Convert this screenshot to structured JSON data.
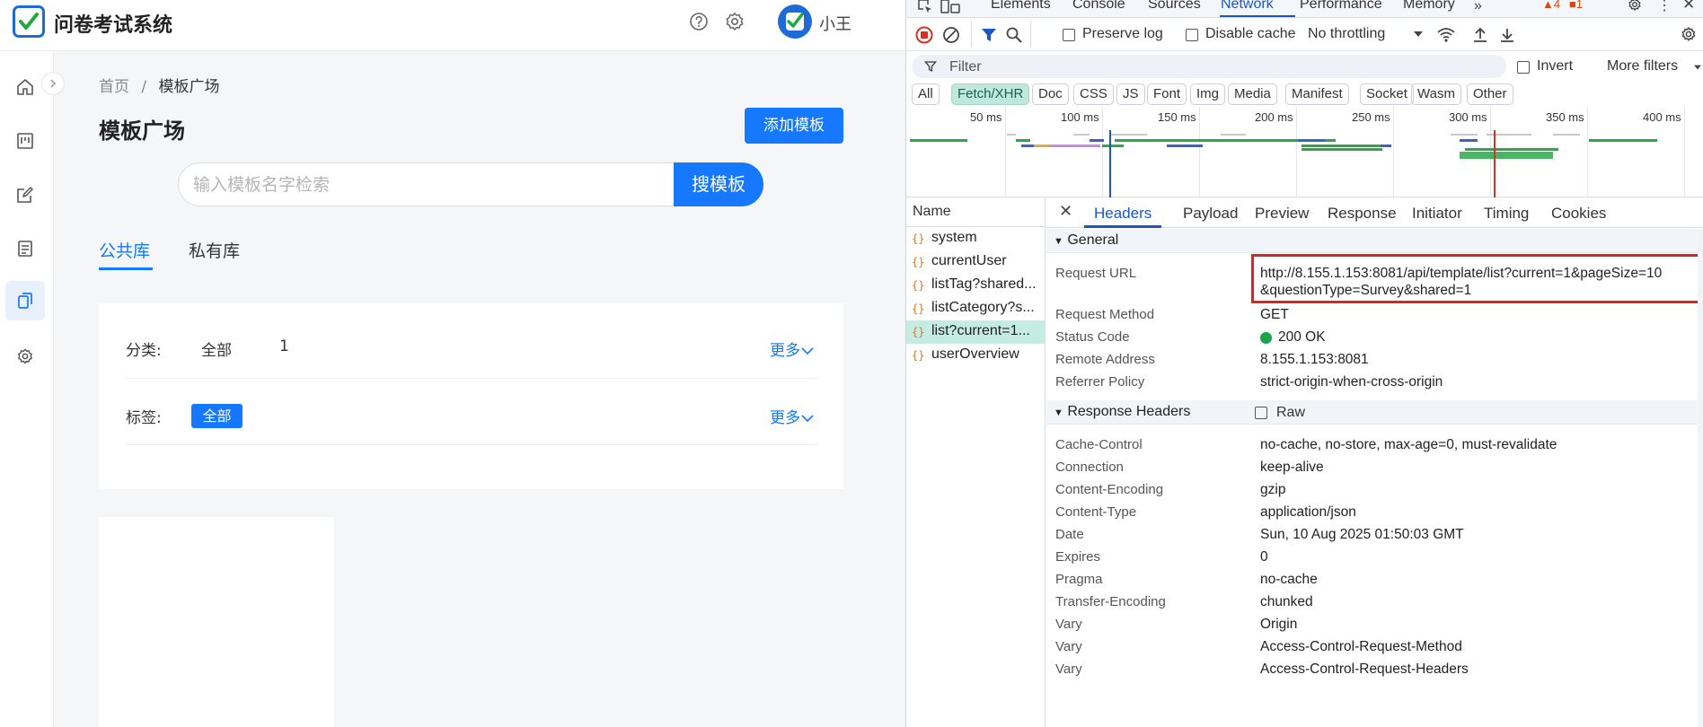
{
  "app": {
    "title": "问卷考试系统",
    "user_name": "小王",
    "breadcrumb": {
      "home": "首页",
      "separator": "/",
      "current": "模板广场"
    },
    "page_title": "模板广场",
    "add_template_label": "添加模板",
    "search": {
      "placeholder": "输入模板名字检索",
      "button_label": "搜模板"
    },
    "tabs": [
      {
        "label": "公共库"
      },
      {
        "label": "私有库"
      }
    ],
    "filters": {
      "category_label": "分类:",
      "category_items": [
        "全部",
        "1"
      ],
      "tag_label": "标签:",
      "tag_items": [
        "全部"
      ],
      "more_label": "更多"
    },
    "colors": {
      "primary": "#1677ff",
      "logo_blue": "#1e6bd8",
      "logo_check": "#1faa3c"
    }
  },
  "devtools": {
    "tabs": [
      "Elements",
      "Console",
      "Sources",
      "Network",
      "Performance",
      "Memory"
    ],
    "active_tab": "Network",
    "badges": {
      "warnings": "4",
      "issues": "1"
    },
    "toolbar": {
      "preserve_log": "Preserve log",
      "disable_cache": "Disable cache",
      "throttling": "No throttling"
    },
    "filter": {
      "placeholder": "Filter",
      "invert": "Invert",
      "more_filters": "More filters"
    },
    "type_filters": [
      "All",
      "Fetch/XHR",
      "Doc",
      "CSS",
      "JS",
      "Font",
      "Img",
      "Media",
      "Manifest",
      "Socket",
      "Wasm",
      "Other"
    ],
    "active_type": "Fetch/XHR",
    "timeline_ticks": [
      "50 ms",
      "100 ms",
      "150 ms",
      "200 ms",
      "250 ms",
      "300 ms",
      "350 ms",
      "400 ms"
    ],
    "name_header": "Name",
    "requests": [
      "system",
      "currentUser",
      "listTag?shared...",
      "listCategory?s...",
      "list?current=1...",
      "userOverview"
    ],
    "selected_request": "list?current=1...",
    "detail_tabs": [
      "Headers",
      "Payload",
      "Preview",
      "Response",
      "Initiator",
      "Timing",
      "Cookies"
    ],
    "general": {
      "title": "General",
      "rows": [
        {
          "key": "Request URL",
          "value": "http://8.155.1.153:8081/api/template/list?current=1&pageSize=10",
          "value2": "&questionType=Survey&shared=1"
        },
        {
          "key": "Request Method",
          "value": "GET"
        },
        {
          "key": "Status Code",
          "value": "200 OK"
        },
        {
          "key": "Remote Address",
          "value": "8.155.1.153:8081"
        },
        {
          "key": "Referrer Policy",
          "value": "strict-origin-when-cross-origin"
        }
      ]
    },
    "response_headers": {
      "title": "Response Headers",
      "raw_label": "Raw",
      "rows": [
        {
          "key": "Cache-Control",
          "value": "no-cache, no-store, max-age=0, must-revalidate"
        },
        {
          "key": "Connection",
          "value": "keep-alive"
        },
        {
          "key": "Content-Encoding",
          "value": "gzip"
        },
        {
          "key": "Content-Type",
          "value": "application/json"
        },
        {
          "key": "Date",
          "value": "Sun, 10 Aug 2025 01:50:03 GMT"
        },
        {
          "key": "Expires",
          "value": "0"
        },
        {
          "key": "Pragma",
          "value": "no-cache"
        },
        {
          "key": "Transfer-Encoding",
          "value": "chunked"
        },
        {
          "key": "Vary",
          "value": "Origin"
        },
        {
          "key": "Vary",
          "value": "Access-Control-Request-Method"
        },
        {
          "key": "Vary",
          "value": "Access-Control-Request-Headers"
        }
      ]
    },
    "colors": {
      "accent": "#1a56c9",
      "selected_row": "#c4ece3",
      "highlight_box": "#e0231e",
      "status_ok": "#1aa34a"
    }
  }
}
